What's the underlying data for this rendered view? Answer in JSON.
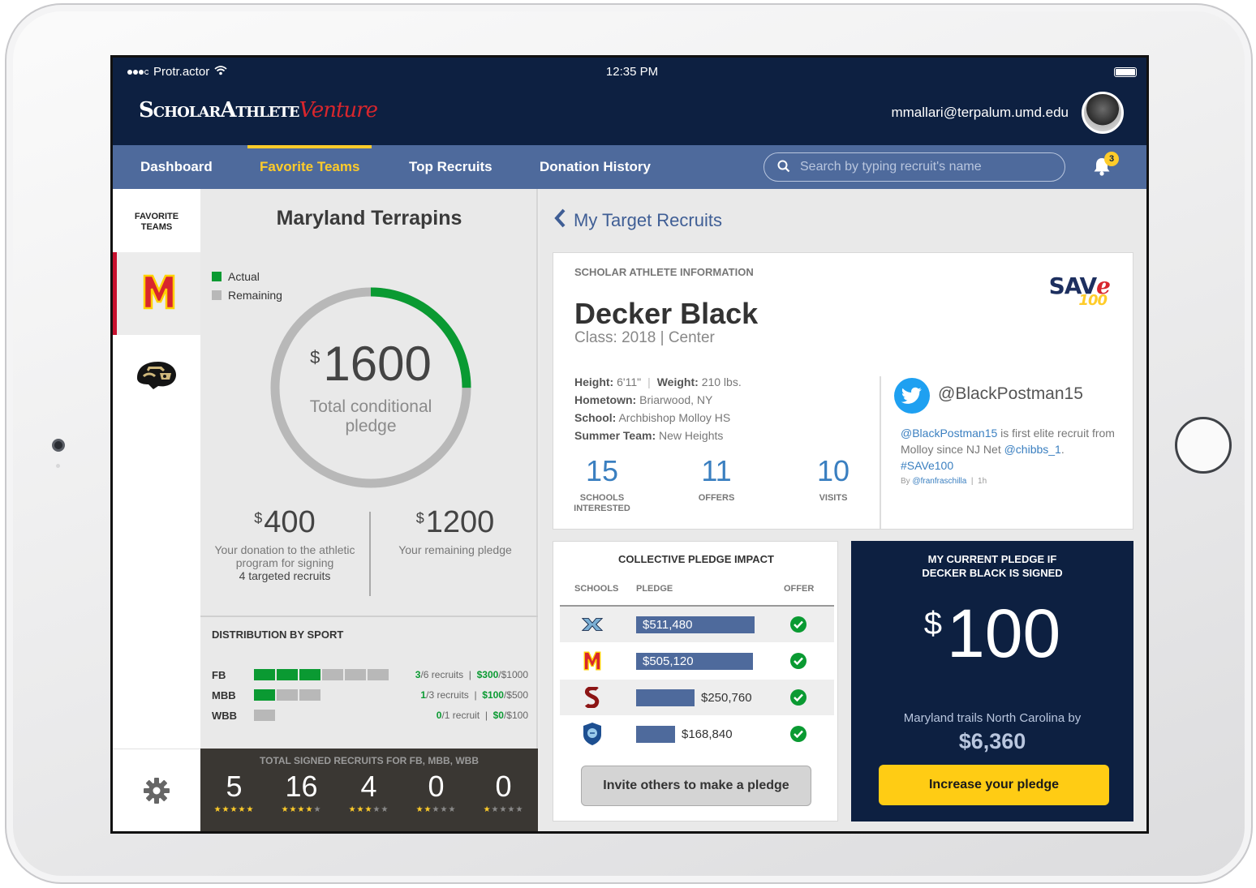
{
  "status_bar": {
    "carrier": "Protr.actor",
    "time": "12:35 PM"
  },
  "header": {
    "logo_primary": "ScholarAthlete",
    "logo_accent": "Venture",
    "user_email": "mmallari@terpalum.umd.edu"
  },
  "nav": {
    "items": [
      {
        "label": "Dashboard",
        "active": false
      },
      {
        "label": "Favorite Teams",
        "active": true
      },
      {
        "label": "Top Recruits",
        "active": false
      },
      {
        "label": "Donation History",
        "active": false
      }
    ],
    "search_placeholder": "Search by typing recruit's name",
    "notification_count": "3"
  },
  "sidebar": {
    "title_line1": "FAVORITE",
    "title_line2": "TEAMS",
    "teams": [
      {
        "icon": "maryland-logo-icon",
        "selected": true
      },
      {
        "icon": "colorado-buffaloes-logo-icon",
        "selected": false
      }
    ]
  },
  "team": {
    "name": "Maryland Terrapins",
    "legend_actual": "Actual",
    "legend_remaining": "Remaining",
    "actual_color": "#0a9a32",
    "remaining_color": "#b8b8b8",
    "pledge_fraction_actual": 0.25,
    "total_currency": "$",
    "total_amount": "1600",
    "total_label": "Total conditional pledge",
    "donation_currency": "$",
    "donation_amount": "400",
    "donation_desc_1": "Your donation to the athletic",
    "donation_desc_2": "program for signing",
    "donation_desc_3": "4 targeted recruits",
    "remaining_currency": "$",
    "remaining_amount": "1200",
    "remaining_desc": "Your remaining pledge"
  },
  "distribution": {
    "title": "DISTRIBUTION BY SPORT",
    "rows": [
      {
        "sport": "FB",
        "signed": 3,
        "total": 6,
        "signed_text": "3",
        "total_text": "/6 recruits",
        "amount": "$300",
        "amount_total": "/$1000"
      },
      {
        "sport": "MBB",
        "signed": 1,
        "total": 3,
        "signed_text": "1",
        "total_text": "/3 recruits",
        "amount": "$100",
        "amount_total": "/$500"
      },
      {
        "sport": "WBB",
        "signed": 0,
        "total": 1,
        "signed_text": "0",
        "total_text": "/1 recruit",
        "amount": "$0",
        "amount_total": "/$100"
      }
    ],
    "separator": "|"
  },
  "signed": {
    "title": "TOTAL SIGNED RECRUITS FOR FB, MBB, WBB",
    "counts": [
      {
        "value": "5",
        "stars": 5
      },
      {
        "value": "16",
        "stars": 4
      },
      {
        "value": "4",
        "stars": 3
      },
      {
        "value": "0",
        "stars": 2
      },
      {
        "value": "0",
        "stars": 1
      }
    ]
  },
  "recruits": {
    "back_label": "My Target Recruits"
  },
  "athlete": {
    "section_label": "SCHOLAR ATHLETE INFORMATION",
    "badge_main": "SAV",
    "badge_accent": "e",
    "badge_number": "100",
    "name": "Decker Black",
    "class_line": "Class: 2018  |  Center",
    "height_label": "Height:",
    "height": "6'11\"",
    "weight_label": "Weight:",
    "weight": "210 lbs.",
    "hometown_label": "Hometown:",
    "hometown": "Briarwood, NY",
    "school_label": "School:",
    "school": "Archbishop Molloy HS",
    "summer_label": "Summer Team:",
    "summer_team": "New Heights",
    "stats": [
      {
        "value": "15",
        "label_1": "SCHOOLS",
        "label_2": "INTERESTED"
      },
      {
        "value": "11",
        "label_1": "OFFERS",
        "label_2": ""
      },
      {
        "value": "10",
        "label_1": "VISITS",
        "label_2": ""
      }
    ],
    "twitter_handle": "@BlackPostman15",
    "tweet_mention": "@BlackPostman15",
    "tweet_part_1": " is first elite recruit from Molloy since NJ Net ",
    "tweet_mention_2": "@chibbs_1",
    "tweet_part_2": ".",
    "tweet_hashtag": "#SAVe100",
    "tweet_by": "By",
    "tweet_author": "@franfraschilla",
    "tweet_time": "1h"
  },
  "impact": {
    "title": "COLLECTIVE PLEDGE IMPACT",
    "col_schools": "SCHOOLS",
    "col_pledge": "PLEDGE",
    "col_offer": "OFFER",
    "rows": [
      {
        "school_icon": "north-carolina-logo-icon",
        "pledge": 511480,
        "pledge_text": "$511,480",
        "offer": true
      },
      {
        "school_icon": "maryland-logo-icon",
        "pledge": 505120,
        "pledge_text": "$505,120",
        "offer": true
      },
      {
        "school_icon": "stanford-logo-icon",
        "pledge": 250760,
        "pledge_text": "$250,760",
        "offer": true
      },
      {
        "school_icon": "columbia-lion-logo-icon",
        "pledge": 168840,
        "pledge_text": "$168,840",
        "offer": true
      }
    ],
    "invite_label": "Invite others to make a pledge"
  },
  "my_pledge": {
    "title_1": "MY CURRENT PLEDGE IF",
    "title_2": "DECKER BLACK IS SIGNED",
    "currency": "$",
    "amount": "100",
    "trail_text": "Maryland trails North Carolina by",
    "trail_amount": "$6,360",
    "increase_label": "Increase your pledge"
  }
}
